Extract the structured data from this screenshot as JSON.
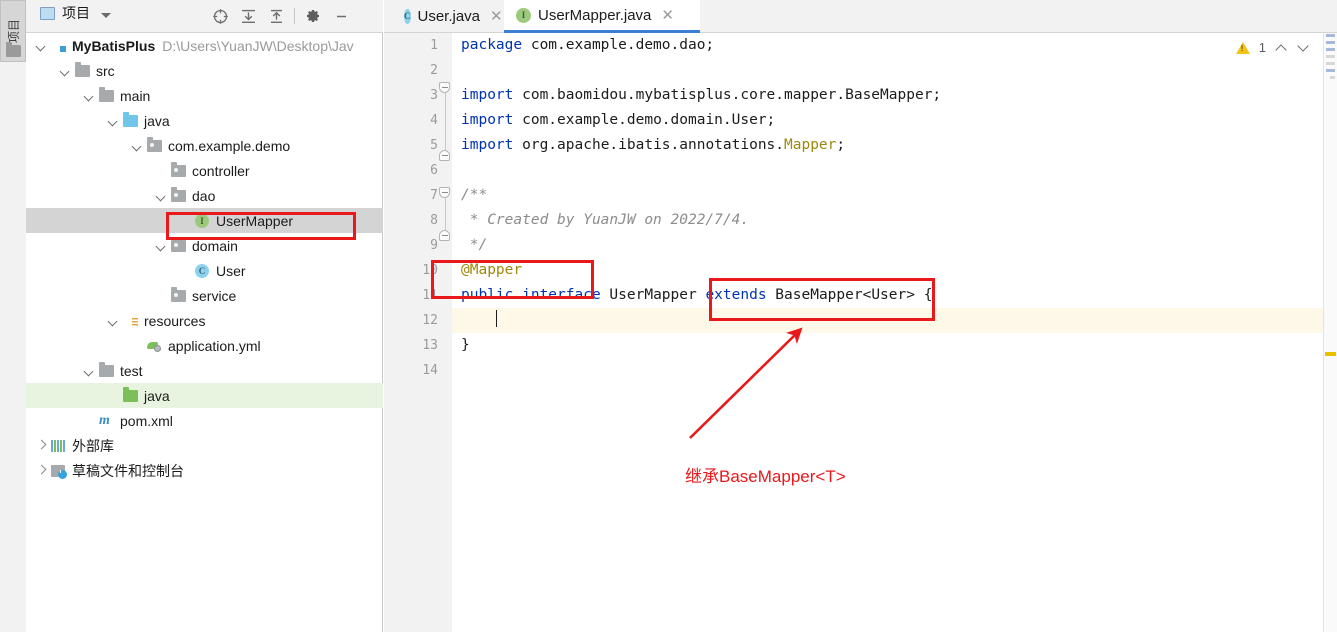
{
  "window": {
    "tool_strip_label": "项目",
    "tool_strip_icon": "project-folder-icon"
  },
  "project_panel": {
    "title": "项目",
    "title_icon": "project-window-icon",
    "dropdown_icon": "chevron-down-icon",
    "header_buttons": [
      {
        "name": "locate-in-tree-icon",
        "glyph": "crosshair"
      },
      {
        "name": "expand-all-icon",
        "glyph": "expand"
      },
      {
        "name": "collapse-all-icon",
        "glyph": "collapse"
      },
      {
        "name": "settings-gear-icon",
        "glyph": "gear"
      },
      {
        "name": "hide-panel-icon",
        "glyph": "minus"
      }
    ],
    "tree": [
      {
        "label": "MyBatisPlus",
        "detail": "D:\\Users\\YuanJW\\Desktop\\Jav",
        "icon": "module-folder-icon",
        "indent": 0,
        "arrow": "down",
        "bold": true,
        "state": "normal"
      },
      {
        "label": "src",
        "detail": "",
        "icon": "folder-icon",
        "indent": 1,
        "arrow": "down",
        "bold": false,
        "state": "normal"
      },
      {
        "label": "main",
        "detail": "",
        "icon": "folder-icon",
        "indent": 2,
        "arrow": "down",
        "bold": false,
        "state": "normal"
      },
      {
        "label": "java",
        "detail": "",
        "icon": "source-root-folder-icon",
        "indent": 3,
        "arrow": "down",
        "bold": false,
        "state": "normal"
      },
      {
        "label": "com.example.demo",
        "detail": "",
        "icon": "package-icon",
        "indent": 4,
        "arrow": "down",
        "bold": false,
        "state": "normal"
      },
      {
        "label": "controller",
        "detail": "",
        "icon": "package-icon",
        "indent": 5,
        "arrow": "none",
        "bold": false,
        "state": "normal"
      },
      {
        "label": "dao",
        "detail": "",
        "icon": "package-icon",
        "indent": 5,
        "arrow": "down",
        "bold": false,
        "state": "normal"
      },
      {
        "label": "UserMapper",
        "detail": "",
        "icon": "interface-icon",
        "indent": 6,
        "arrow": "none",
        "bold": false,
        "state": "selected"
      },
      {
        "label": "domain",
        "detail": "",
        "icon": "package-icon",
        "indent": 5,
        "arrow": "down",
        "bold": false,
        "state": "normal"
      },
      {
        "label": "User",
        "detail": "",
        "icon": "class-icon",
        "indent": 6,
        "arrow": "none",
        "bold": false,
        "state": "normal"
      },
      {
        "label": "service",
        "detail": "",
        "icon": "package-icon",
        "indent": 5,
        "arrow": "none",
        "bold": false,
        "state": "normal"
      },
      {
        "label": "resources",
        "detail": "",
        "icon": "resources-folder-icon",
        "indent": 3,
        "arrow": "down",
        "bold": false,
        "state": "normal"
      },
      {
        "label": "application.yml",
        "detail": "",
        "icon": "yaml-file-icon",
        "indent": 4,
        "arrow": "none",
        "bold": false,
        "state": "normal"
      },
      {
        "label": "test",
        "detail": "",
        "icon": "folder-icon",
        "indent": 2,
        "arrow": "down",
        "bold": false,
        "state": "normal"
      },
      {
        "label": "java",
        "detail": "",
        "icon": "test-source-folder-icon",
        "indent": 3,
        "arrow": "none",
        "bold": false,
        "state": "green"
      },
      {
        "label": "pom.xml",
        "detail": "",
        "icon": "maven-file-icon",
        "indent": 2,
        "arrow": "none",
        "bold": false,
        "state": "normal"
      },
      {
        "label": "外部库",
        "detail": "",
        "icon": "external-libraries-icon",
        "indent": 0,
        "arrow": "right",
        "bold": false,
        "state": "normal"
      },
      {
        "label": "草稿文件和控制台",
        "detail": "",
        "icon": "scratches-consoles-icon",
        "indent": 0,
        "arrow": "right",
        "bold": false,
        "state": "normal"
      }
    ]
  },
  "editor": {
    "tabs": [
      {
        "label": "User.java",
        "badge": "C",
        "badge_kind": "class",
        "active": false,
        "close_icon": "close-icon"
      },
      {
        "label": "UserMapper.java",
        "badge": "I",
        "badge_kind": "interface",
        "active": true,
        "close_icon": "close-icon"
      }
    ],
    "inspection": {
      "warning_icon": "warning-triangle-icon",
      "count": "1",
      "prev_icon": "chevron-up-icon",
      "next_icon": "chevron-down-icon"
    },
    "line_numbers": [
      "1",
      "2",
      "3",
      "4",
      "5",
      "6",
      "7",
      "8",
      "9",
      "10",
      "11",
      "12",
      "13",
      "14"
    ],
    "current_line": "12",
    "lines": [
      {
        "n": "1",
        "tokens": [
          {
            "t": "package",
            "c": "kw"
          },
          {
            "t": " com.example.demo.dao;",
            "c": "plain"
          }
        ]
      },
      {
        "n": "2",
        "tokens": []
      },
      {
        "n": "3",
        "tokens": [
          {
            "t": "import",
            "c": "kw"
          },
          {
            "t": " com.baomidou.mybatisplus.core.mapper.BaseMapper;",
            "c": "plain"
          }
        ]
      },
      {
        "n": "4",
        "tokens": [
          {
            "t": "import",
            "c": "kw"
          },
          {
            "t": " com.example.demo.domain.User;",
            "c": "plain"
          }
        ]
      },
      {
        "n": "5",
        "tokens": [
          {
            "t": "import",
            "c": "kw"
          },
          {
            "t": " org.apache.ibatis.annotations.",
            "c": "plain"
          },
          {
            "t": "Mapper",
            "c": "anno"
          },
          {
            "t": ";",
            "c": "plain"
          }
        ]
      },
      {
        "n": "6",
        "tokens": []
      },
      {
        "n": "7",
        "tokens": [
          {
            "t": "/**",
            "c": "cmt"
          }
        ]
      },
      {
        "n": "8",
        "tokens": [
          {
            "t": " * Created by YuanJW on 2022/7/4.",
            "c": "cmt"
          }
        ]
      },
      {
        "n": "9",
        "tokens": [
          {
            "t": " */",
            "c": "cmt"
          }
        ]
      },
      {
        "n": "10",
        "tokens": [
          {
            "t": "@Mapper",
            "c": "anno"
          }
        ]
      },
      {
        "n": "11",
        "tokens": [
          {
            "t": "public interface",
            "c": "kw"
          },
          {
            "t": " UserMapper ",
            "c": "plain"
          },
          {
            "t": "extends",
            "c": "kw"
          },
          {
            "t": " BaseMapper<User> {",
            "c": "plain"
          }
        ]
      },
      {
        "n": "12",
        "tokens": [],
        "caret": true
      },
      {
        "n": "13",
        "tokens": [
          {
            "t": "}",
            "c": "plain"
          }
        ]
      },
      {
        "n": "14",
        "tokens": []
      }
    ]
  },
  "annotations": {
    "callout_text": "继承BaseMapper<T>",
    "color": "#e8181b",
    "boxes": [
      {
        "name": "highlight-box-usermapper-node"
      },
      {
        "name": "highlight-box-mapper-annotation"
      },
      {
        "name": "highlight-box-extends-clause"
      }
    ],
    "arrow": {
      "name": "callout-arrow",
      "from": "继承BaseMapper<T>",
      "to": "extends BaseMapper<User>"
    }
  }
}
